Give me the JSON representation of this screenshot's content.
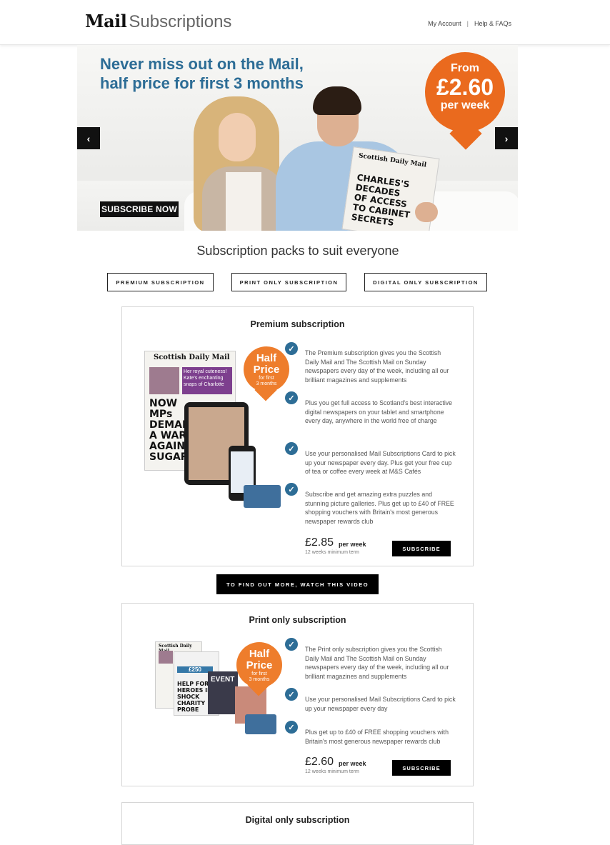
{
  "header": {
    "logo_mail": "Mail",
    "logo_subs": "Subscriptions",
    "nav_account": "My Account",
    "nav_sep": "|",
    "nav_help": "Help & FAQs"
  },
  "hero": {
    "headline_line1": "Never miss out on the Mail,",
    "headline_line2": "half price for first 3 months",
    "badge_from": "From",
    "badge_price": "£2.60",
    "badge_per": "per week",
    "cta": "SUBSCRIBE NOW",
    "prev_icon": "‹",
    "next_icon": "›",
    "newspaper_masthead": "Scottish Daily Mail",
    "newspaper_headline": "CHARLES'S DECADES OF ACCESS TO CABINET SECRETS"
  },
  "section_title": "Subscription packs to suit everyone",
  "tabs": [
    "PREMIUM SUBSCRIPTION",
    "PRINT ONLY SUBSCRIPTION",
    "DIGITAL ONLY SUBSCRIPTION"
  ],
  "premium": {
    "title": "Premium subscription",
    "badge_big1": "Half",
    "badge_big2": "Price",
    "badge_small1": "for first",
    "badge_small2": "3 months",
    "np_masthead": "Scottish Daily Mail",
    "np_headline": "NOW MPs DEMAND A WAR AGAINST SUGAR",
    "np_teaser": "Her royal cuteness! Kate's enchanting snaps of Charlotte",
    "features": [
      "The Premium subscription gives you the Scottish Daily Mail and The Scottish Mail on Sunday newspapers every day of the week, including all our brilliant magazines and supplements",
      "Plus you get full access to Scotland's best interactive digital newspapers on your tablet and smartphone every day, anywhere in the world free of charge",
      "Use your personalised Mail Subscriptions Card to pick up your newspaper every day. Plus get your free cup of tea or coffee every week at M&S Cafés",
      "Subscribe and get amazing extra puzzles and stunning picture galleries. Plus get up to £40 of FREE shopping vouchers with Britain's most generous newspaper rewards club"
    ],
    "price": "£2.85",
    "per_week": "per week",
    "min_term": "12 weeks minimum term",
    "subscribe": "SUBSCRIBE"
  },
  "video_button": "TO FIND OUT MORE, WATCH THIS VIDEO",
  "print": {
    "title": "Print only subscription",
    "badge_big1": "Half",
    "badge_big2": "Price",
    "badge_small1": "for first",
    "badge_small2": "3 months",
    "np_masthead": "Scottish Daily Mail",
    "np_headline": "HELP FOR HEROES IN SHOCK CHARITY PROBE",
    "mag_price": "£250",
    "mag_name": "EVENT",
    "features": [
      "The Print only subscription gives you the Scottish Daily Mail and The Scottish Mail on Sunday newspapers every day of the week, including all our brilliant magazines and supplements",
      "Use your personalised Mail Subscriptions Card to pick up your newspaper every day",
      "Plus get up to £40 of FREE shopping vouchers with Britain's most generous newspaper rewards club"
    ],
    "price": "£2.60",
    "per_week": "per week",
    "min_term": "12 weeks minimum term",
    "subscribe": "SUBSCRIBE"
  },
  "digital": {
    "title": "Digital only subscription"
  },
  "colors": {
    "accent_blue": "#2d6d96",
    "orange": "#ea6a1e",
    "black": "#000000"
  },
  "icons": {
    "check": "✓",
    "prev": "chevron-left-icon",
    "next": "chevron-right-icon"
  }
}
